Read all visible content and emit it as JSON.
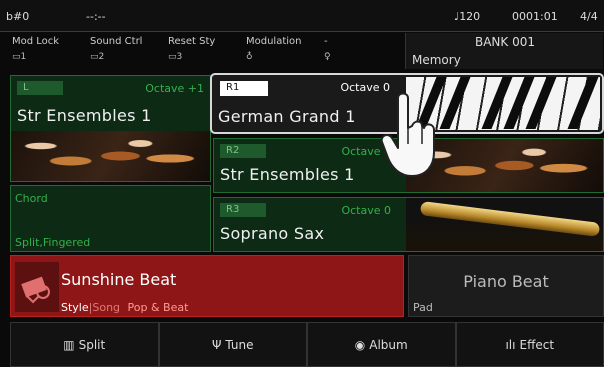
{
  "status": {
    "key": "b#0",
    "chord_display": "--:--",
    "tempo": "♩120",
    "measure": "0001:01",
    "time_sig": "4/4"
  },
  "controls": [
    {
      "label": "Mod Lock",
      "sub": "▭1"
    },
    {
      "label": "Sound Ctrl",
      "sub": "▭2"
    },
    {
      "label": "Reset Sty",
      "sub": "▭3"
    },
    {
      "label": "Modulation",
      "sub": "♁"
    },
    {
      "label": "-",
      "sub": "♀"
    }
  ],
  "bank": {
    "title": "BANK 001",
    "memory": "Memory"
  },
  "voices": {
    "l": {
      "tag": "L",
      "octave": "Octave +1",
      "name": "Str Ensembles 1"
    },
    "r1": {
      "tag": "R1",
      "octave": "Octave 0",
      "name": "German Grand 1"
    },
    "r2": {
      "tag": "R2",
      "octave": "Octave 0",
      "name": "Str Ensembles 1"
    },
    "r3": {
      "tag": "R3",
      "octave": "Octave 0",
      "name": "Soprano Sax"
    }
  },
  "chord": {
    "title": "Chord",
    "mode": "Split,Fingered"
  },
  "style": {
    "name": "Sunshine Beat",
    "tab_style": "Style",
    "separator": "|",
    "tab_song": "Song",
    "category": "Pop & Beat"
  },
  "pad": {
    "name": "Piano Beat",
    "label": "Pad"
  },
  "bottom": [
    {
      "label": "Split",
      "icon": "keyboard-icon"
    },
    {
      "label": "Tune",
      "icon": "tuning-fork-icon"
    },
    {
      "label": "Album",
      "icon": "album-icon"
    },
    {
      "label": "Effect",
      "icon": "effect-bars-icon"
    }
  ],
  "colors": {
    "accent_green": "#34b04c",
    "style_red": "#8e1616"
  }
}
